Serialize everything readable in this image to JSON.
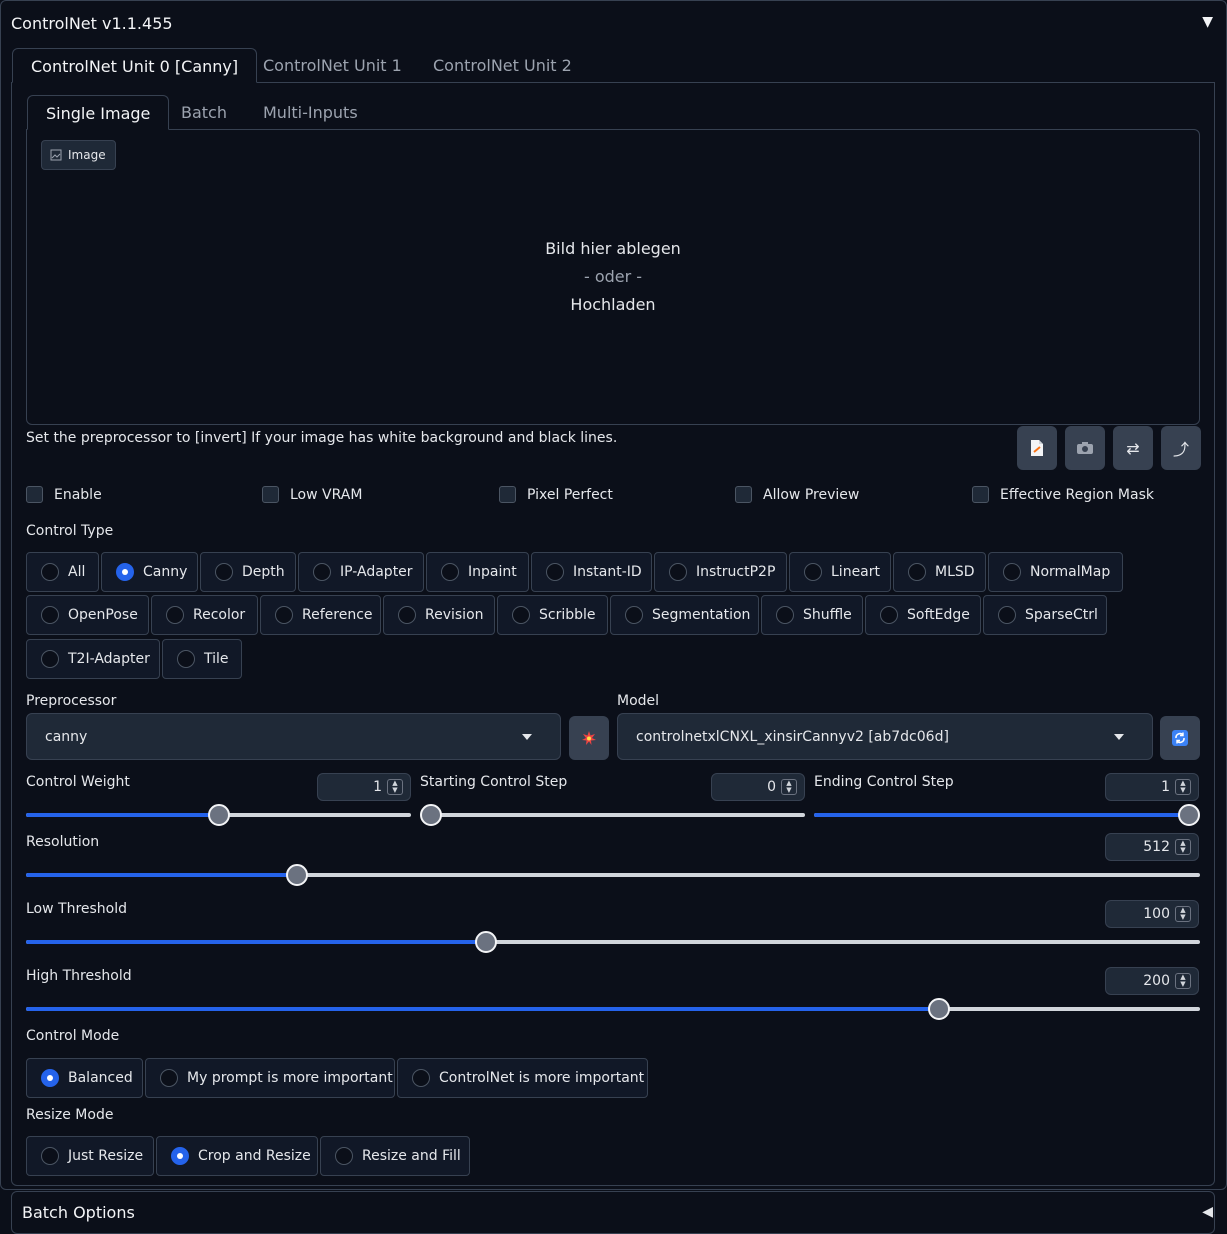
{
  "header": {
    "title": "ControlNet v1.1.455",
    "toggle_icon": "▼"
  },
  "unit_tabs": [
    "ControlNet Unit 0 [Canny]",
    "ControlNet Unit 1",
    "ControlNet Unit 2"
  ],
  "input_tabs": [
    "Single Image",
    "Batch",
    "Multi-Inputs"
  ],
  "image": {
    "label": "Image",
    "drop_text": "Bild hier ablegen",
    "or_text": "- oder -",
    "upload_text": "Hochladen"
  },
  "hint": "Set the preprocessor to [invert] If your image has white background and black lines.",
  "tool_buttons": [
    "document-icon",
    "camera-icon",
    "swap-icon",
    "send-dimensions-icon"
  ],
  "checkboxes": [
    "Enable",
    "Low VRAM",
    "Pixel Perfect",
    "Allow Preview",
    "Effective Region Mask"
  ],
  "control_type": {
    "label": "Control Type",
    "selected": "Canny",
    "options": [
      "All",
      "Canny",
      "Depth",
      "IP-Adapter",
      "Inpaint",
      "Instant-ID",
      "InstructP2P",
      "Lineart",
      "MLSD",
      "NormalMap",
      "OpenPose",
      "Recolor",
      "Reference",
      "Revision",
      "Scribble",
      "Segmentation",
      "Shuffle",
      "SoftEdge",
      "SparseCtrl",
      "T2I-Adapter",
      "Tile"
    ]
  },
  "preprocessor": {
    "label": "Preprocessor",
    "value": "canny",
    "run_icon": "explosion-icon"
  },
  "model": {
    "label": "Model",
    "value": "controlnetxlCNXL_xinsirCannyv2 [ab7dc06d]",
    "refresh_icon": "refresh-icon"
  },
  "sliders": {
    "control_weight": {
      "label": "Control Weight",
      "value": "1",
      "fraction": 0.5
    },
    "starting_step": {
      "label": "Starting Control Step",
      "value": "0",
      "fraction": 0.0
    },
    "ending_step": {
      "label": "Ending Control Step",
      "value": "1",
      "fraction": 1.0
    },
    "resolution": {
      "label": "Resolution",
      "value": "512",
      "fraction": 0.231
    },
    "low_threshold": {
      "label": "Low Threshold",
      "value": "100",
      "fraction": 0.392
    },
    "high_threshold": {
      "label": "High Threshold",
      "value": "200",
      "fraction": 0.778
    }
  },
  "control_mode": {
    "label": "Control Mode",
    "selected": "Balanced",
    "options": [
      "Balanced",
      "My prompt is more important",
      "ControlNet is more important"
    ]
  },
  "resize_mode": {
    "label": "Resize Mode",
    "selected": "Crop and Resize",
    "options": [
      "Just Resize",
      "Crop and Resize",
      "Resize and Fill"
    ]
  },
  "batch_options": {
    "title": "Batch Options",
    "toggle_icon": "◀"
  },
  "colors": {
    "background": "#0b0f19",
    "accent": "#2563eb",
    "border": "#374151",
    "surface": "#1f2937"
  }
}
